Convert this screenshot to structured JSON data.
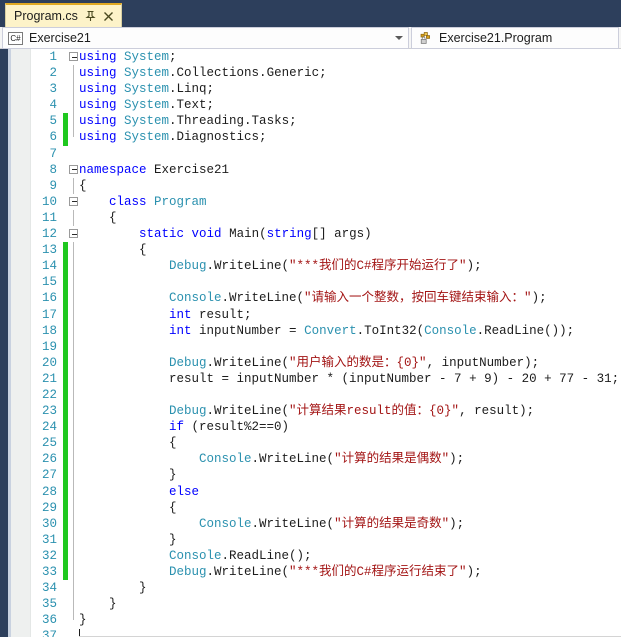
{
  "window": {
    "background_color": "#2d3f5c"
  },
  "tab": {
    "label": "Program.cs",
    "pin_icon": "pin-icon",
    "close_icon": "close-icon",
    "active_border_color": "#e0a923",
    "background_color": "#fdf3c9"
  },
  "navbar": {
    "left_combo": {
      "icon": "csharp-project-icon",
      "icon_label": "C#",
      "value": "Exercise21"
    },
    "right_combo": {
      "icon": "class-member-icon",
      "value": "Exercise21.Program"
    },
    "dropdown_arrow_icon": "chevron-down-icon"
  },
  "editor": {
    "keyword_color": "#0000ff",
    "type_color": "#2b91af",
    "string_color": "#a31515",
    "line_number_color": "#2b91af",
    "change_marker_color": "#1fc81f",
    "caret_line": 37,
    "lines": [
      {
        "n": 1,
        "changed": false,
        "fold": "open",
        "text": "using System;"
      },
      {
        "n": 2,
        "changed": false,
        "fold": "bar",
        "text": "using System.Collections.Generic;"
      },
      {
        "n": 3,
        "changed": false,
        "fold": "bar",
        "text": "using System.Linq;"
      },
      {
        "n": 4,
        "changed": false,
        "fold": "bar",
        "text": "using System.Text;"
      },
      {
        "n": 5,
        "changed": true,
        "fold": "bar",
        "text": "using System.Threading.Tasks;"
      },
      {
        "n": 6,
        "changed": true,
        "fold": "endbar",
        "text": "using System.Diagnostics;"
      },
      {
        "n": 7,
        "changed": false,
        "fold": "none",
        "text": ""
      },
      {
        "n": 8,
        "changed": false,
        "fold": "open",
        "text": "namespace Exercise21"
      },
      {
        "n": 9,
        "changed": false,
        "fold": "bar",
        "text": "{"
      },
      {
        "n": 10,
        "changed": false,
        "fold": "open",
        "text": "    class Program"
      },
      {
        "n": 11,
        "changed": false,
        "fold": "bar",
        "text": "    {"
      },
      {
        "n": 12,
        "changed": false,
        "fold": "open",
        "text": "        static void Main(string[] args)"
      },
      {
        "n": 13,
        "changed": true,
        "fold": "bar",
        "text": "        {"
      },
      {
        "n": 14,
        "changed": true,
        "fold": "bar",
        "text": "            Debug.WriteLine(\"***我们的C#程序开始运行了\");"
      },
      {
        "n": 15,
        "changed": true,
        "fold": "bar",
        "text": ""
      },
      {
        "n": 16,
        "changed": true,
        "fold": "bar",
        "text": "            Console.WriteLine(\"请输入一个整数，按回车键结束输入：\");"
      },
      {
        "n": 17,
        "changed": true,
        "fold": "bar",
        "text": "            int result;"
      },
      {
        "n": 18,
        "changed": true,
        "fold": "bar",
        "text": "            int inputNumber = Convert.ToInt32(Console.ReadLine());"
      },
      {
        "n": 19,
        "changed": true,
        "fold": "bar",
        "text": ""
      },
      {
        "n": 20,
        "changed": true,
        "fold": "bar",
        "text": "            Debug.WriteLine(\"用户输入的数是：{0}\", inputNumber);"
      },
      {
        "n": 21,
        "changed": true,
        "fold": "bar",
        "text": "            result = inputNumber * (inputNumber - 7 + 9) - 20 + 77 - 31;"
      },
      {
        "n": 22,
        "changed": true,
        "fold": "bar",
        "text": ""
      },
      {
        "n": 23,
        "changed": true,
        "fold": "bar",
        "text": "            Debug.WriteLine(\"计算结果result的值：{0}\", result);"
      },
      {
        "n": 24,
        "changed": true,
        "fold": "bar",
        "text": "            if (result%2==0)"
      },
      {
        "n": 25,
        "changed": true,
        "fold": "bar",
        "text": "            {"
      },
      {
        "n": 26,
        "changed": true,
        "fold": "bar",
        "text": "                Console.WriteLine(\"计算的结果是偶数\");"
      },
      {
        "n": 27,
        "changed": true,
        "fold": "bar",
        "text": "            }"
      },
      {
        "n": 28,
        "changed": true,
        "fold": "bar",
        "text": "            else"
      },
      {
        "n": 29,
        "changed": true,
        "fold": "bar",
        "text": "            {"
      },
      {
        "n": 30,
        "changed": true,
        "fold": "bar",
        "text": "                Console.WriteLine(\"计算的结果是奇数\");"
      },
      {
        "n": 31,
        "changed": true,
        "fold": "bar",
        "text": "            }"
      },
      {
        "n": 32,
        "changed": true,
        "fold": "bar",
        "text": "            Console.ReadLine();"
      },
      {
        "n": 33,
        "changed": true,
        "fold": "bar",
        "text": "            Debug.WriteLine(\"***我们的C#程序运行结束了\");"
      },
      {
        "n": 34,
        "changed": false,
        "fold": "bar",
        "text": "        }"
      },
      {
        "n": 35,
        "changed": false,
        "fold": "bar",
        "text": "    }"
      },
      {
        "n": 36,
        "changed": false,
        "fold": "endbar",
        "text": "}"
      },
      {
        "n": 37,
        "changed": false,
        "fold": "none",
        "text": ""
      }
    ]
  }
}
